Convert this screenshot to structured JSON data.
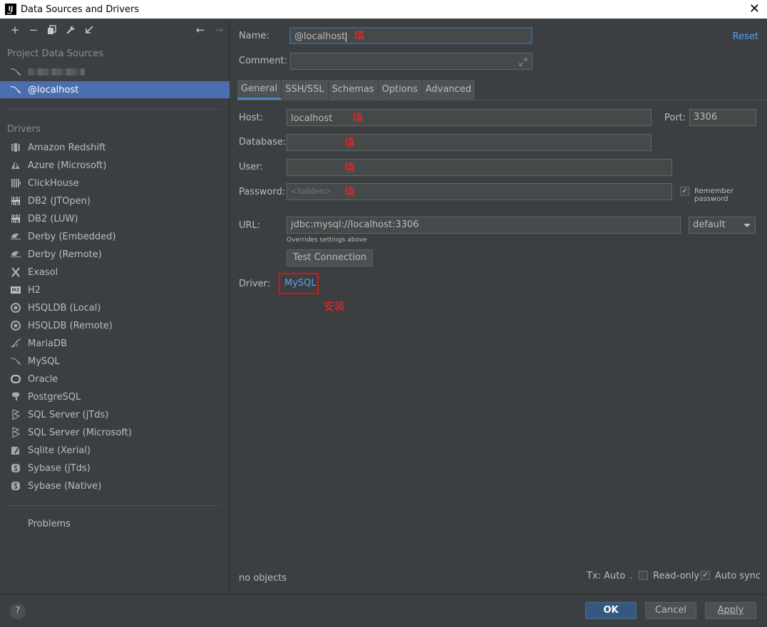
{
  "window": {
    "title": "Data Sources and Drivers",
    "app_icon": "IJ"
  },
  "toolbar": {
    "add": "+",
    "remove": "−",
    "duplicate": "⧉",
    "settings": "🔧",
    "import": "↙",
    "back": "←",
    "forward": "→"
  },
  "sidebar": {
    "project_header": "Project Data Sources",
    "sources": [
      {
        "label": "",
        "blurred": true,
        "icon": "mysql-icon"
      },
      {
        "label": "@localhost",
        "icon": "mysql-icon",
        "selected": true
      }
    ],
    "drivers_header": "Drivers",
    "drivers": [
      {
        "label": "Amazon Redshift",
        "icon": "redshift-icon"
      },
      {
        "label": "Azure (Microsoft)",
        "icon": "azure-icon"
      },
      {
        "label": "ClickHouse",
        "icon": "clickhouse-icon"
      },
      {
        "label": "DB2 (JTOpen)",
        "icon": "db2-icon"
      },
      {
        "label": "DB2 (LUW)",
        "icon": "db2-icon"
      },
      {
        "label": "Derby (Embedded)",
        "icon": "derby-icon"
      },
      {
        "label": "Derby (Remote)",
        "icon": "derby-icon"
      },
      {
        "label": "Exasol",
        "icon": "exasol-icon"
      },
      {
        "label": "H2",
        "icon": "h2-icon"
      },
      {
        "label": "HSQLDB (Local)",
        "icon": "hsqldb-icon"
      },
      {
        "label": "HSQLDB (Remote)",
        "icon": "hsqldb-icon"
      },
      {
        "label": "MariaDB",
        "icon": "mariadb-icon"
      },
      {
        "label": "MySQL",
        "icon": "mysql-icon"
      },
      {
        "label": "Oracle",
        "icon": "oracle-icon"
      },
      {
        "label": "PostgreSQL",
        "icon": "postgresql-icon"
      },
      {
        "label": "SQL Server (jTds)",
        "icon": "sqlserver-icon"
      },
      {
        "label": "SQL Server (Microsoft)",
        "icon": "sqlserver-icon"
      },
      {
        "label": "Sqlite (Xerial)",
        "icon": "sqlite-icon"
      },
      {
        "label": "Sybase (jTds)",
        "icon": "sybase-icon"
      },
      {
        "label": "Sybase (Native)",
        "icon": "sybase-icon"
      }
    ],
    "problems": "Problems"
  },
  "form": {
    "name_label": "Name:",
    "name_value": "@localhost",
    "comment_label": "Comment:",
    "comment_value": "",
    "reset": "Reset",
    "tabs": [
      "General",
      "SSH/SSL",
      "Schemas",
      "Options",
      "Advanced"
    ],
    "active_tab": "General",
    "host_label": "Host:",
    "host_value": "localhost",
    "port_label": "Port:",
    "port_value": "3306",
    "database_label": "Database:",
    "database_value": "",
    "user_label": "User:",
    "user_value": "",
    "password_label": "Password:",
    "password_placeholder": "<hidden>",
    "remember_password": "Remember password",
    "remember_checked": true,
    "url_label": "URL:",
    "url_value": "jdbc:mysql://localhost:3306",
    "url_hint": "Overrides settings above",
    "url_mode": "default",
    "test_connection": "Test Connection",
    "driver_label": "Driver:",
    "driver_value": "MySQL"
  },
  "annotations": {
    "fill": "填",
    "install": "安装",
    "color": "#ff2020"
  },
  "status": {
    "objects": "no objects",
    "tx_mode": "Tx: Auto",
    "read_only": "Read-only",
    "read_only_checked": false,
    "auto_sync": "Auto sync",
    "auto_sync_checked": true
  },
  "footer": {
    "help": "?",
    "ok": "OK",
    "cancel": "Cancel",
    "apply": "Apply"
  },
  "colors": {
    "background": "#3c3f41",
    "selection": "#4b6eaf",
    "link": "#589df6",
    "primary_button": "#365880"
  }
}
